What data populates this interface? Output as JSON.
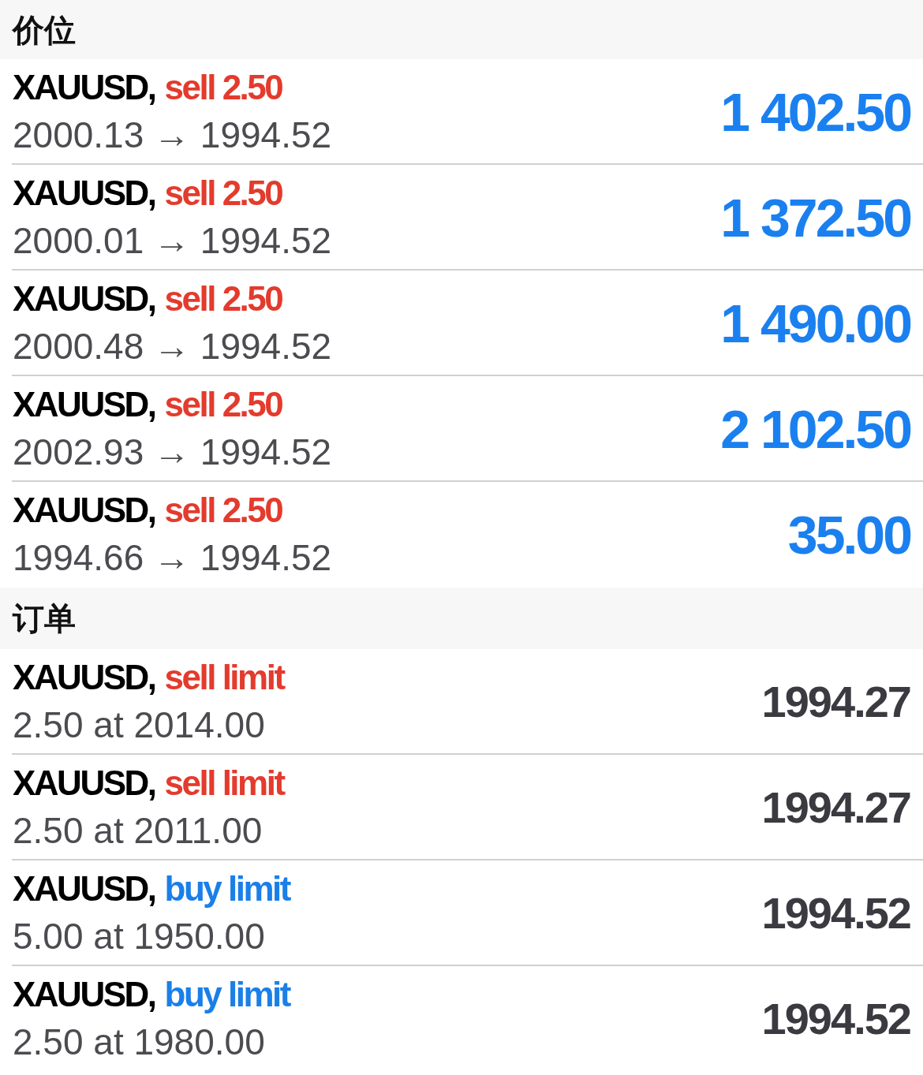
{
  "sections": [
    {
      "title": "价位",
      "kind": "positions",
      "items": [
        {
          "symbol": "XAUUSD,",
          "kind": "sell",
          "order": "sell 2.50",
          "detail": "2000.13 → 1994.52",
          "value": "1 402.50"
        },
        {
          "symbol": "XAUUSD,",
          "kind": "sell",
          "order": "sell 2.50",
          "detail": "2000.01 → 1994.52",
          "value": "1 372.50"
        },
        {
          "symbol": "XAUUSD,",
          "kind": "sell",
          "order": "sell 2.50",
          "detail": "2000.48 → 1994.52",
          "value": "1 490.00"
        },
        {
          "symbol": "XAUUSD,",
          "kind": "sell",
          "order": "sell 2.50",
          "detail": "2002.93 → 1994.52",
          "value": "2 102.50"
        },
        {
          "symbol": "XAUUSD,",
          "kind": "sell",
          "order": "sell 2.50",
          "detail": "1994.66 → 1994.52",
          "value": "35.00"
        }
      ]
    },
    {
      "title": "订单",
      "kind": "orders",
      "items": [
        {
          "symbol": "XAUUSD,",
          "kind": "sell",
          "order": "sell limit",
          "detail": "2.50 at 2014.00",
          "value": "1994.27"
        },
        {
          "symbol": "XAUUSD,",
          "kind": "sell",
          "order": "sell limit",
          "detail": "2.50 at 2011.00",
          "value": "1994.27"
        },
        {
          "symbol": "XAUUSD,",
          "kind": "buy",
          "order": "buy limit",
          "detail": "5.00 at 1950.00",
          "value": "1994.52"
        },
        {
          "symbol": "XAUUSD,",
          "kind": "buy",
          "order": "buy limit",
          "detail": "2.50 at 1980.00",
          "value": "1994.52"
        }
      ]
    }
  ]
}
